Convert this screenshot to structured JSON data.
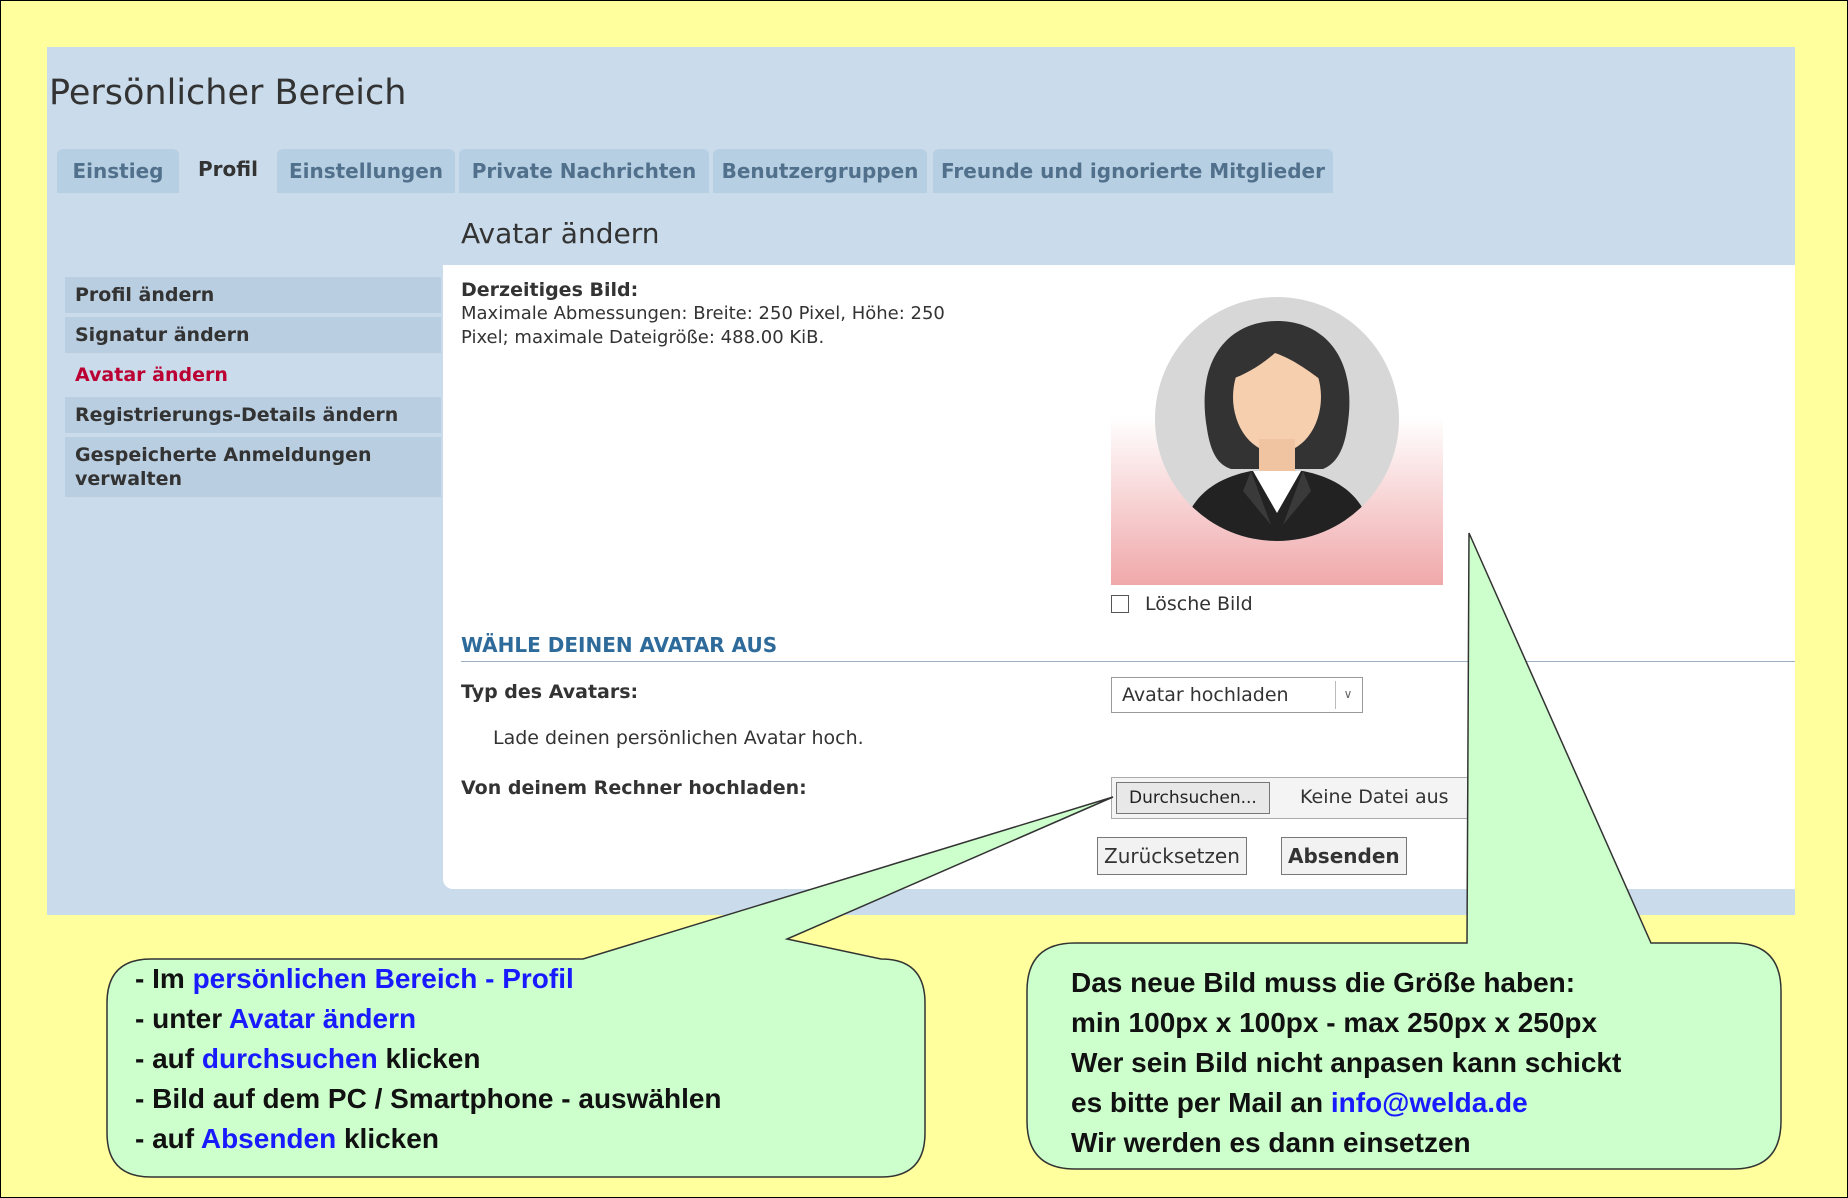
{
  "colors": {
    "background": "#ffff9e",
    "panel": "#cadceb",
    "active_menu": "#bb0033",
    "callout_fill": "#ccffcc",
    "highlight_text": "#1a1aff"
  },
  "page_title": "Persönlicher Bereich",
  "tabs": [
    {
      "label": "Einstieg",
      "active": false
    },
    {
      "label": "Profil",
      "active": true
    },
    {
      "label": "Einstellungen",
      "active": false
    },
    {
      "label": "Private Nachrichten",
      "active": false
    },
    {
      "label": "Benutzergruppen",
      "active": false
    },
    {
      "label": "Freunde und ignorierte Mitglieder",
      "active": false
    }
  ],
  "sidebar": {
    "items": [
      {
        "label": "Profil ändern",
        "active": false
      },
      {
        "label": "Signatur ändern",
        "active": false
      },
      {
        "label": "Avatar ändern",
        "active": true
      },
      {
        "label": "Registrierungs-Details ändern",
        "active": false
      },
      {
        "label": "Gespeicherte Anmeldungen verwalten",
        "active": false
      }
    ]
  },
  "main": {
    "section_title": "Avatar ändern",
    "current_image_label": "Derzeitiges Bild:",
    "current_image_info_line1": "Maximale Abmessungen: Breite: 250 Pixel, Höhe: 250",
    "current_image_info_line2": "Pixel; maximale Dateigröße: 488.00 KiB.",
    "delete_image_label": "Lösche Bild",
    "choose_avatar_title": "WÄHLE DEINEN AVATAR AUS",
    "avatar_type_label": "Typ des Avatars:",
    "avatar_type_value": "Avatar hochladen",
    "avatar_type_hint": "Lade deinen persönlichen Avatar hoch.",
    "upload_label": "Von deinem Rechner hochladen:",
    "browse_button": "Durchsuchen...",
    "file_status": "Keine Datei aus",
    "reset_button": "Zurücksetzen",
    "submit_button": "Absenden"
  },
  "callout_left": {
    "line1_prefix": "- Im ",
    "line1_highlight": "persönlichen Bereich - Profil",
    "line2_prefix": "- unter ",
    "line2_highlight": "Avatar ändern",
    "line3_prefix": "- auf ",
    "line3_highlight": "durchsuchen",
    "line3_suffix": " klicken",
    "line4": "- Bild auf dem PC / Smartphone - auswählen",
    "line5_prefix": "- auf ",
    "line5_highlight": "Absenden",
    "line5_suffix": " klicken"
  },
  "callout_right": {
    "line1": "Das neue Bild muss die Größe haben:",
    "line2": "min 100px x 100px - max 250px x 250px",
    "line3": "Wer sein Bild nicht anpasen kann schickt",
    "line4_prefix": "es bitte per Mail an ",
    "line4_highlight": "info@welda.de",
    "line5": "Wir werden es dann einsetzen"
  }
}
